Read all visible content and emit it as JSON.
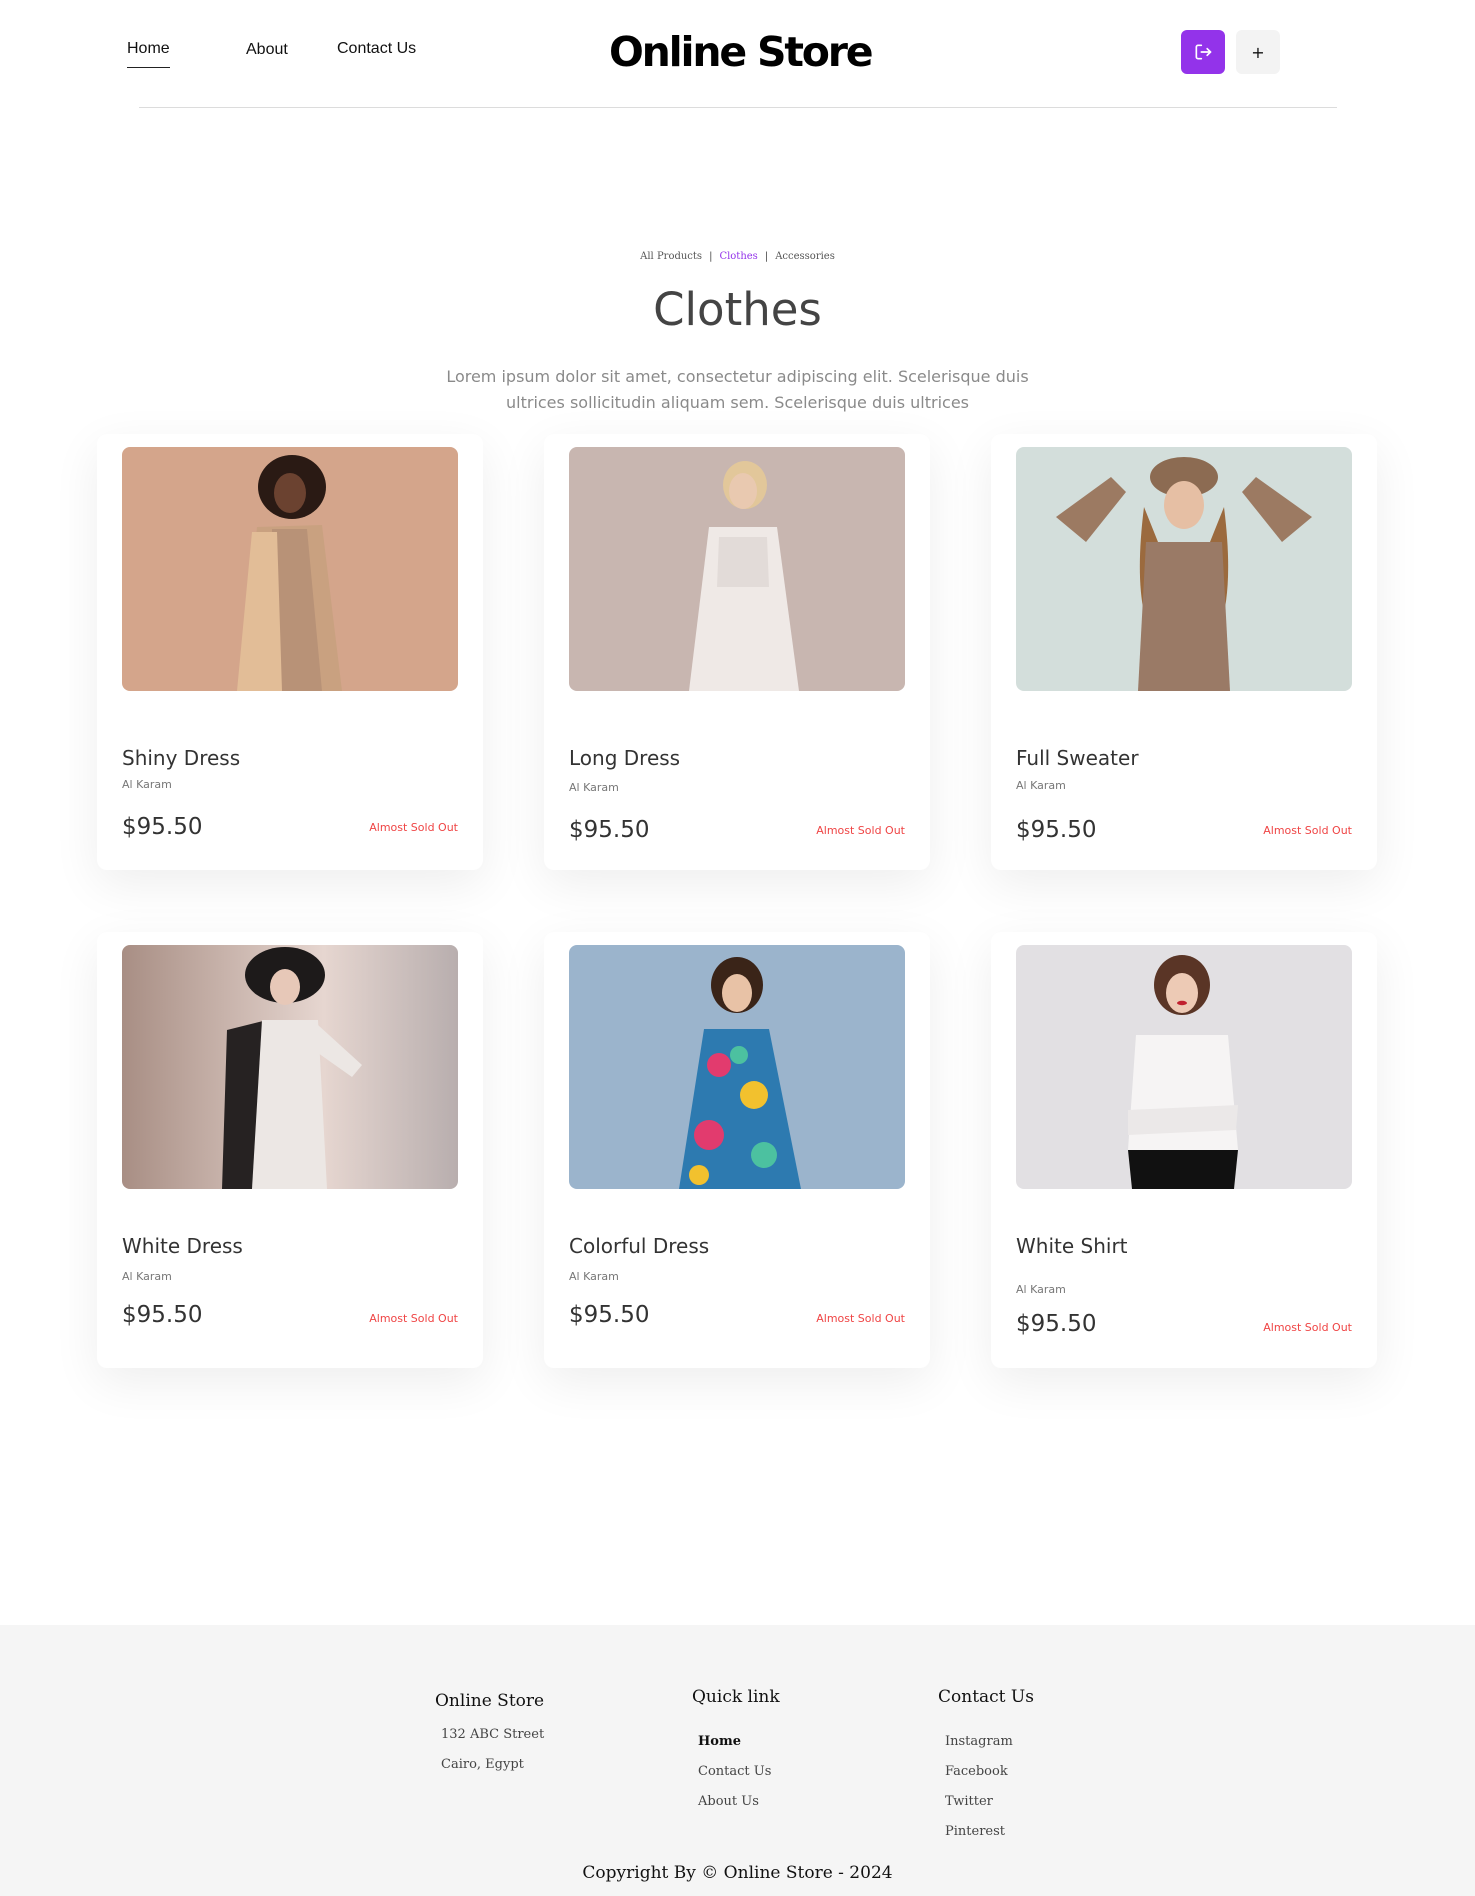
{
  "header": {
    "nav": [
      "Home",
      "About",
      "Contact Us"
    ],
    "brand": "Online Store",
    "add_label": "+",
    "accent_color": "#9333ea"
  },
  "section": {
    "breadcrumbs": [
      "All Products",
      "Clothes",
      "Accessories"
    ],
    "active_breadcrumb": "Clothes",
    "title": "Clothes",
    "description": "Lorem ipsum dolor sit amet, consectetur adipiscing elit. Scelerisque duis ultrices sollicitudin aliquam sem. Scelerisque duis ultrices"
  },
  "products": [
    {
      "name": "Shiny Dress",
      "brand": "Al Karam",
      "price": "$95.50",
      "status": "Almost Sold Out"
    },
    {
      "name": "Long Dress",
      "brand": "Al Karam",
      "price": "$95.50",
      "status": "Almost Sold Out"
    },
    {
      "name": "Full Sweater",
      "brand": "Al Karam",
      "price": "$95.50",
      "status": "Almost Sold Out"
    },
    {
      "name": "White Dress",
      "brand": "Al Karam",
      "price": "$95.50",
      "status": "Almost Sold Out"
    },
    {
      "name": "Colorful Dress",
      "brand": "Al Karam",
      "price": "$95.50",
      "status": "Almost Sold Out"
    },
    {
      "name": "White Shirt",
      "brand": "Al Karam",
      "price": "$95.50",
      "status": "Almost Sold Out"
    }
  ],
  "footer": {
    "store": {
      "title": "Online Store",
      "lines": [
        "132 ABC Street",
        "Cairo, Egypt"
      ]
    },
    "quick": {
      "title": "Quick link",
      "links": [
        "Home",
        "Contact Us",
        "About Us"
      ]
    },
    "contact": {
      "title": "Contact Us",
      "links": [
        "Instagram",
        "Facebook",
        "Twitter",
        "Pinterest"
      ]
    },
    "copyright": "Copyright By © Online Store - 2024"
  },
  "icons": {
    "logout": "logout-icon",
    "add": "plus-icon"
  },
  "colors": {
    "status": "#ef4444",
    "footer_bg": "#f5f5f5"
  }
}
